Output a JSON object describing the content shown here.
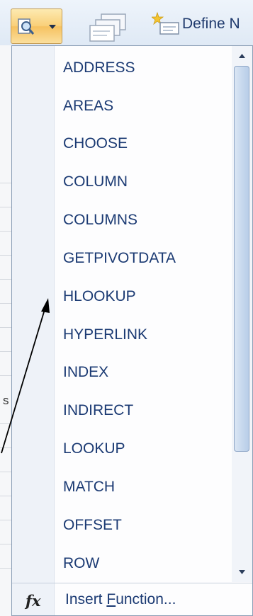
{
  "ribbon": {
    "define_name_label": "Define N"
  },
  "background": {
    "sheet_letter": "s"
  },
  "menu": {
    "items": [
      {
        "label": "ADDRESS"
      },
      {
        "label": "AREAS"
      },
      {
        "label": "CHOOSE"
      },
      {
        "label": "COLUMN"
      },
      {
        "label": "COLUMNS"
      },
      {
        "label": "GETPIVOTDATA"
      },
      {
        "label": "HLOOKUP"
      },
      {
        "label": "HYPERLINK"
      },
      {
        "label": "INDEX"
      },
      {
        "label": "INDIRECT"
      },
      {
        "label": "LOOKUP"
      },
      {
        "label": "MATCH"
      },
      {
        "label": "OFFSET"
      },
      {
        "label": "ROW"
      }
    ],
    "footer": {
      "fx_icon": "fx",
      "insert_function_prefix": "Insert ",
      "insert_function_accel": "F",
      "insert_function_suffix": "unction..."
    }
  },
  "colors": {
    "menu_text": "#1b3a73",
    "ribbon_button_active": "#f9cf78",
    "gutter": "#eef2f8"
  }
}
